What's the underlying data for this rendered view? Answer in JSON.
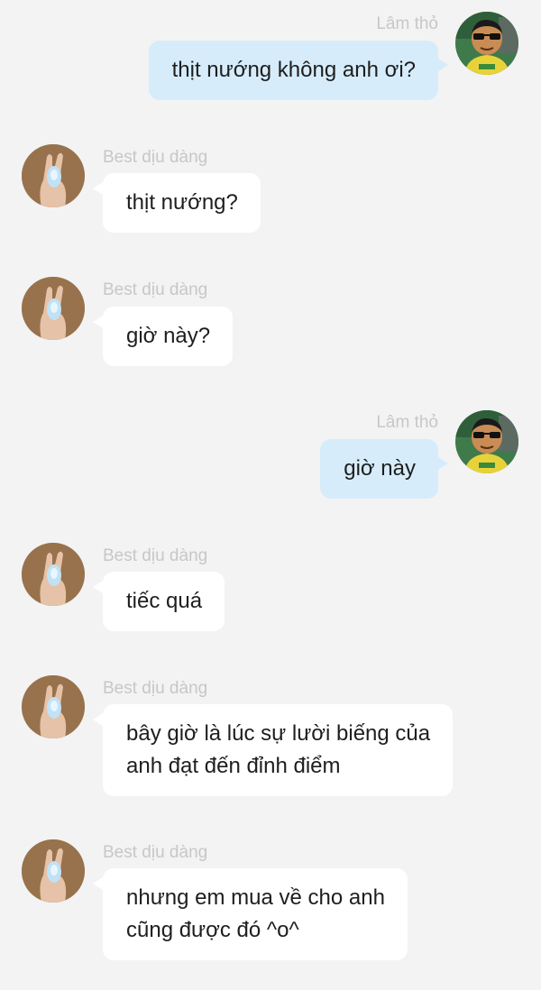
{
  "conversation": {
    "messages": [
      {
        "sender": "Lâm thỏ",
        "direction": "outgoing",
        "lines": [
          "thịt nướng không anh ơi?"
        ]
      },
      {
        "sender": "Best dịu dàng",
        "direction": "incoming",
        "lines": [
          "thịt nướng?"
        ]
      },
      {
        "sender": "Best dịu dàng",
        "direction": "incoming",
        "lines": [
          "giờ này?"
        ]
      },
      {
        "sender": "Lâm thỏ",
        "direction": "outgoing",
        "lines": [
          "giờ này"
        ]
      },
      {
        "sender": "Best dịu dàng",
        "direction": "incoming",
        "lines": [
          "tiếc quá"
        ]
      },
      {
        "sender": "Best dịu dàng",
        "direction": "incoming",
        "lines": [
          "bây giờ là lúc sự lười biếng của",
          "anh đạt đến đỉnh điểm"
        ]
      },
      {
        "sender": "Best dịu dàng",
        "direction": "incoming",
        "lines": [
          "nhưng em mua về cho anh",
          "cũng được đó ^o^"
        ]
      }
    ]
  },
  "colors": {
    "background": "#f3f3f3",
    "outgoing_bubble": "#d6ecfb",
    "incoming_bubble": "#ffffff",
    "sender_name": "#c7c7c7",
    "message_text": "#1e1e1e"
  },
  "icons": {
    "outgoing_avatar": "cartoon-man-sunglasses-avatar",
    "incoming_avatar": "peace-sign-hand-avatar"
  }
}
